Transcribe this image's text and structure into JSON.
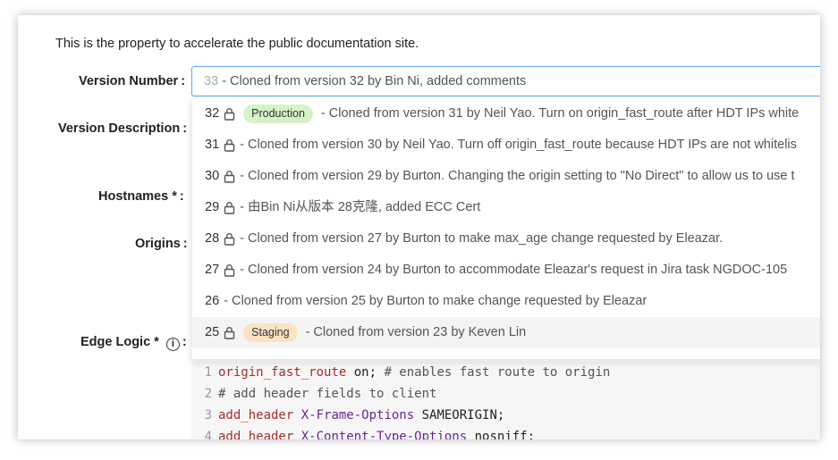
{
  "intro_text": "This is the property to accelerate the public documentation site.",
  "labels": {
    "version_number": "Version Number",
    "version_description": "Version Description",
    "hostnames": "Hostnames *",
    "origins": "Origins",
    "edge_logic": "Edge Logic *",
    "colon": ":"
  },
  "info_icon_glyph": "i",
  "version_input": {
    "number": "33",
    "separator": " - ",
    "text": "Cloned from version 32 by Bin Ni, added comments"
  },
  "options": [
    {
      "number": "32",
      "locked": true,
      "badge": "Production",
      "text": "- Cloned from version 31 by Neil Yao. Turn on origin_fast_route after HDT IPs white"
    },
    {
      "number": "31",
      "locked": true,
      "badge": "",
      "text": "- Cloned from version 30 by Neil Yao. Turn off origin_fast_route because HDT IPs are not whitelis"
    },
    {
      "number": "30",
      "locked": true,
      "badge": "",
      "text": "- Cloned from version 29 by Burton. Changing the origin setting to \"No Direct\" to allow us to use t"
    },
    {
      "number": "29",
      "locked": true,
      "badge": "",
      "text": "- 由Bin Ni从版本 28克隆, added ECC Cert"
    },
    {
      "number": "28",
      "locked": true,
      "badge": "",
      "text": "- Cloned from version 27 by Burton to make max_age change requested by Eleazar."
    },
    {
      "number": "27",
      "locked": true,
      "badge": "",
      "text": "- Cloned from version 24 by Burton to accommodate Eleazar's request in Jira task NGDOC-105"
    },
    {
      "number": "26",
      "locked": false,
      "badge": "",
      "text": "- Cloned from version 25 by Burton to make change requested by Eleazar"
    },
    {
      "number": "25",
      "locked": true,
      "badge": "Staging",
      "text": "- Cloned from version 23 by Keven Lin"
    }
  ],
  "code": {
    "lines": [
      {
        "n": "1",
        "a": "origin_fast_route",
        "b": " on;",
        "c": " # enables fast route to origin"
      },
      {
        "n": "2",
        "a": "",
        "b": "",
        "c": "# add header fields to client"
      },
      {
        "n": "3",
        "a": "add_header",
        "b": " X-Frame-Options",
        "c": " SAMEORIGIN;"
      },
      {
        "n": "4",
        "a": "add_header",
        "b": " X-Content-Type-Options",
        "c": " nosniff;"
      }
    ]
  },
  "colors": {
    "focus_border": "#5ea6ea",
    "production_badge": "#d5f2c9",
    "staging_badge": "#fbe3c4"
  }
}
